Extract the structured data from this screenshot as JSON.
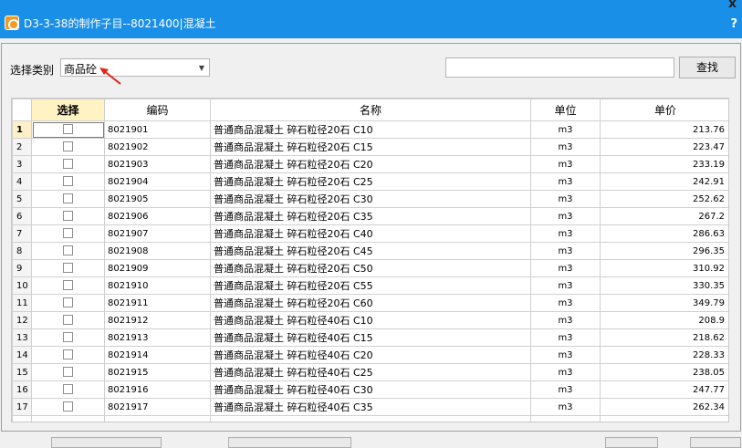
{
  "window": {
    "title": "D3-3-38的制作子目--8021400|混凝土",
    "help": "?",
    "close": "x"
  },
  "filter": {
    "label": "选择类别",
    "category_value": "商品砼",
    "search_value": "",
    "search_button": "查找"
  },
  "table": {
    "headers": [
      "",
      "选择",
      "编码",
      "名称",
      "单位",
      "单价"
    ],
    "rows": [
      {
        "n": "1",
        "code": "8021901",
        "name": "普通商品混凝土 碎石粒径20石 C10",
        "unit": "m3",
        "price": "213.76"
      },
      {
        "n": "2",
        "code": "8021902",
        "name": "普通商品混凝土 碎石粒径20石 C15",
        "unit": "m3",
        "price": "223.47"
      },
      {
        "n": "3",
        "code": "8021903",
        "name": "普通商品混凝土 碎石粒径20石 C20",
        "unit": "m3",
        "price": "233.19"
      },
      {
        "n": "4",
        "code": "8021904",
        "name": "普通商品混凝土 碎石粒径20石 C25",
        "unit": "m3",
        "price": "242.91"
      },
      {
        "n": "5",
        "code": "8021905",
        "name": "普通商品混凝土 碎石粒径20石 C30",
        "unit": "m3",
        "price": "252.62"
      },
      {
        "n": "6",
        "code": "8021906",
        "name": "普通商品混凝土 碎石粒径20石 C35",
        "unit": "m3",
        "price": "267.2"
      },
      {
        "n": "7",
        "code": "8021907",
        "name": "普通商品混凝土 碎石粒径20石 C40",
        "unit": "m3",
        "price": "286.63"
      },
      {
        "n": "8",
        "code": "8021908",
        "name": "普通商品混凝土 碎石粒径20石 C45",
        "unit": "m3",
        "price": "296.35"
      },
      {
        "n": "9",
        "code": "8021909",
        "name": "普通商品混凝土 碎石粒径20石 C50",
        "unit": "m3",
        "price": "310.92"
      },
      {
        "n": "10",
        "code": "8021910",
        "name": "普通商品混凝土 碎石粒径20石 C55",
        "unit": "m3",
        "price": "330.35"
      },
      {
        "n": "11",
        "code": "8021911",
        "name": "普通商品混凝土 碎石粒径20石 C60",
        "unit": "m3",
        "price": "349.79"
      },
      {
        "n": "12",
        "code": "8021912",
        "name": "普通商品混凝土 碎石粒径40石 C10",
        "unit": "m3",
        "price": "208.9"
      },
      {
        "n": "13",
        "code": "8021913",
        "name": "普通商品混凝土 碎石粒径40石 C15",
        "unit": "m3",
        "price": "218.62"
      },
      {
        "n": "14",
        "code": "8021914",
        "name": "普通商品混凝土 碎石粒径40石 C20",
        "unit": "m3",
        "price": "228.33"
      },
      {
        "n": "15",
        "code": "8021915",
        "name": "普通商品混凝土 碎石粒径40石 C25",
        "unit": "m3",
        "price": "238.05"
      },
      {
        "n": "16",
        "code": "8021916",
        "name": "普通商品混凝土 碎石粒径40石 C30",
        "unit": "m3",
        "price": "247.77"
      },
      {
        "n": "17",
        "code": "8021917",
        "name": "普通商品混凝土 碎石粒径40石 C35",
        "unit": "m3",
        "price": "262.34"
      }
    ]
  },
  "colors": {
    "titlebar": "#1a8fe8",
    "select_header": "#fff3c4",
    "annotation_arrow": "#e0261c"
  },
  "icons": {
    "app": "app-logo-icon",
    "dropdown": "chevron-down-icon",
    "annotation": "red-arrow-icon"
  }
}
